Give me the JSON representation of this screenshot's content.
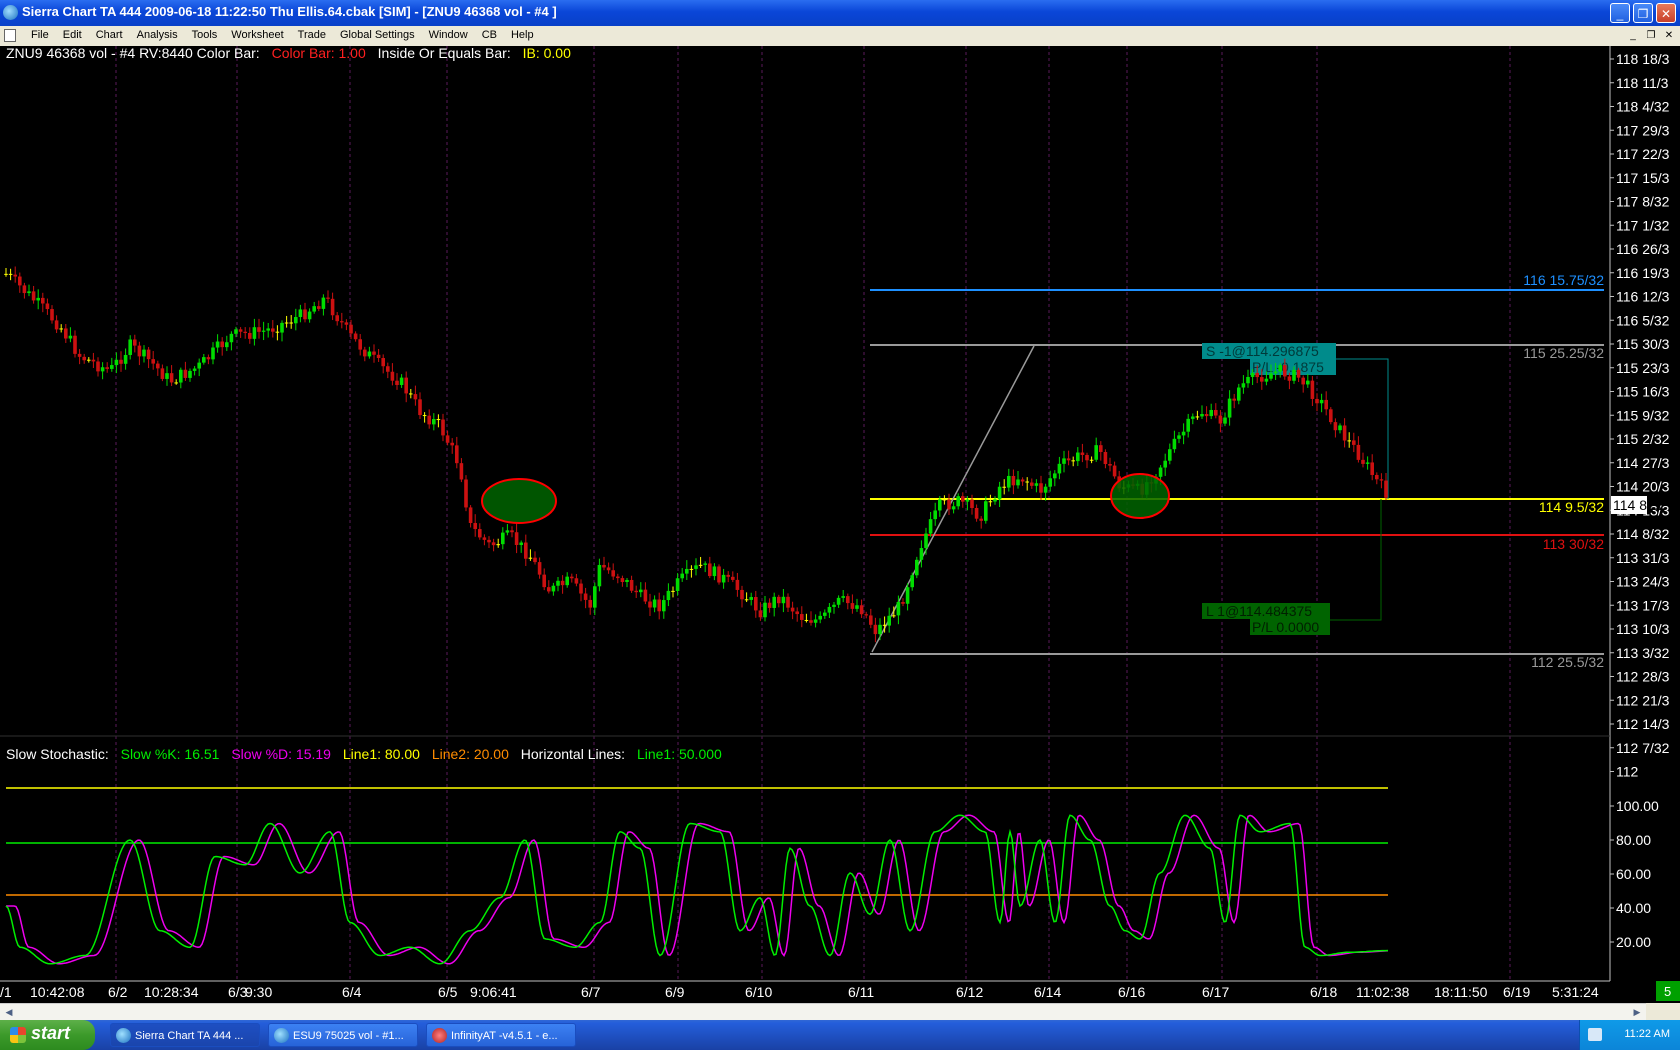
{
  "window": {
    "title": "Sierra Chart TA 444   2009-06-18  11:22:50  Thu    Ellis.64.cbak [SIM] - [ZNU9  46368 vol - #4 ]",
    "minimize": "_",
    "restore": "❐",
    "close": "✕"
  },
  "menu": {
    "items": [
      "File",
      "Edit",
      "Chart",
      "Analysis",
      "Tools",
      "Worksheet",
      "Trade",
      "Global Settings",
      "Window",
      "CB",
      "Help"
    ],
    "mdi": [
      "_",
      "❐",
      "✕"
    ]
  },
  "header": {
    "symbol": "ZNU9  46368 vol - #4  RV:8440  Color Bar:",
    "color_bar_value": "Color Bar: 1.00",
    "ib_label": "Inside Or Equals Bar:",
    "ib_value": "IB: 0.00"
  },
  "price_axis": {
    "labels": [
      "118 18/3",
      "118 11/3",
      "118 4/32",
      "117 29/3",
      "117 22/3",
      "117 15/3",
      "117 8/32",
      "117 1/32",
      "116 26/3",
      "116 19/3",
      "116 12/3",
      "116 5/32",
      "115 30/3",
      "115 23/3",
      "115 16/3",
      "115 9/32",
      "115 2/32",
      "114 27/3",
      "114 20/3",
      "114 13/3",
      "114 8/32",
      "113 31/3",
      "113 24/3",
      "113 17/3",
      "113 10/3",
      "113 3/32",
      "112 28/3",
      "112 21/3",
      "112 14/3",
      "112 7/32",
      "112"
    ],
    "current": "114 8/32"
  },
  "levels": [
    {
      "label": "116 15.75/32",
      "color": "#1e90ff"
    },
    {
      "label": "115 25.25/32",
      "color": "#9a9a9a"
    },
    {
      "label": "114 9.5/32",
      "color": "#ffff00"
    },
    {
      "label": "113 30/32",
      "color": "#e01010"
    },
    {
      "label": "112 25.5/32",
      "color": "#9a9a9a"
    }
  ],
  "orders": {
    "short_entry": "S -1@114.296875",
    "short_pl": "P/L -0.1875",
    "long_entry": "L 1@114.484375",
    "long_pl": "P/L 0.0000"
  },
  "stochastic": {
    "title": "Slow Stochastic:",
    "k": "Slow %K: 16.51",
    "d": "Slow %D: 15.19",
    "line1": "Line1: 80.00",
    "line2": "Line2: 20.00",
    "hlines_label": "Horizontal Lines:",
    "hline1": "Line1: 50.000",
    "axis": [
      "100.00",
      "80.00",
      "60.00",
      "40.00",
      "20.00"
    ]
  },
  "time_axis": [
    "/1",
    "10:42:08",
    "6/2",
    "10:28:34",
    "6/3",
    "9:30",
    "6/4",
    "6/5",
    "9:06:41",
    "6/7",
    "6/9",
    "6/10",
    "6/11",
    "6/12",
    "6/14",
    "6/16",
    "6/17",
    "6/18",
    "11:02:38",
    "18:11:50",
    "6/19",
    "5:31:24"
  ],
  "corner_badge": "5",
  "scrollbar": {
    "left": "◀",
    "right": "▶"
  },
  "taskbar": {
    "start": "start",
    "tasks": [
      "Sierra Chart TA 444 ...",
      "ESU9  75025 vol - #1...",
      "InfinityAT -v4.5.1 - e..."
    ],
    "clock": "11:22 AM"
  },
  "colors": {
    "up_candle": "#00dd00",
    "down_candle": "#cc1111",
    "doji": "#ffff00",
    "stoch_k": "#00ee00",
    "stoch_d": "#ee00ee"
  }
}
